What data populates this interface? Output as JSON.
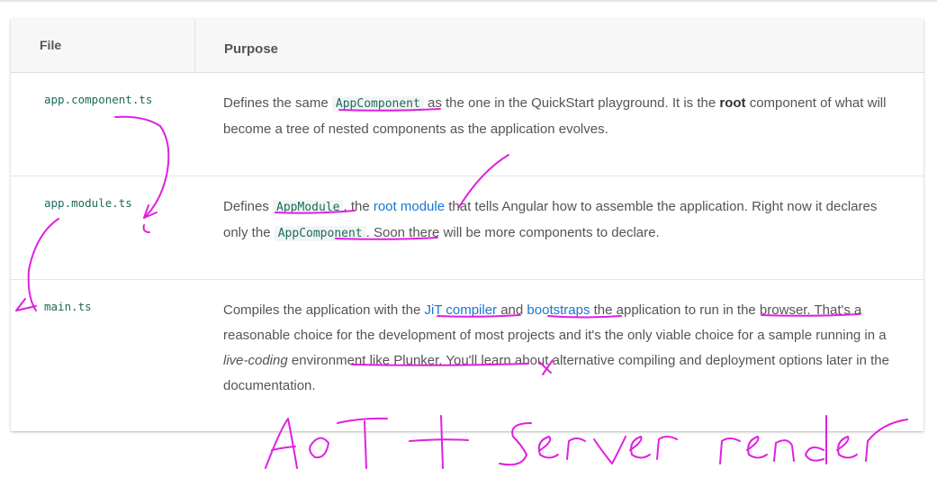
{
  "table": {
    "headers": {
      "file": "File",
      "purpose": "Purpose"
    },
    "rows": [
      {
        "file": "app.component.ts",
        "purpose": {
          "t1": "Defines the same ",
          "code1": "AppComponent",
          "t2": " as the one in the QuickStart playground. It is the ",
          "bold": "root",
          "t3": " component of what will become a tree of nested components as the application evolves."
        }
      },
      {
        "file": "app.module.ts",
        "purpose": {
          "t1": "Defines ",
          "code1": "AppModule",
          "t2": ", the ",
          "link1": "root module",
          "t3": " that tells Angular how to assemble the application. Right now it declares only the ",
          "code2": "AppComponent",
          "t4": ". Soon there will be more components to declare."
        }
      },
      {
        "file": "main.ts",
        "purpose": {
          "t1": "Compiles the application with the ",
          "link1": "JiT compiler",
          "t2": " and ",
          "link2": "bootstraps",
          "t3": " the application to run in the browser. That's a reasonable choice for the development of most projects and it's the only viable choice for a sample running in a ",
          "italic": "live-coding",
          "t4": " environment like Plunker. You'll learn about alternative compiling and deployment options later in the documentation."
        }
      }
    ]
  },
  "annotation": {
    "handwritten_text": "AoT + Server render",
    "ink_color": "#e020e0"
  }
}
